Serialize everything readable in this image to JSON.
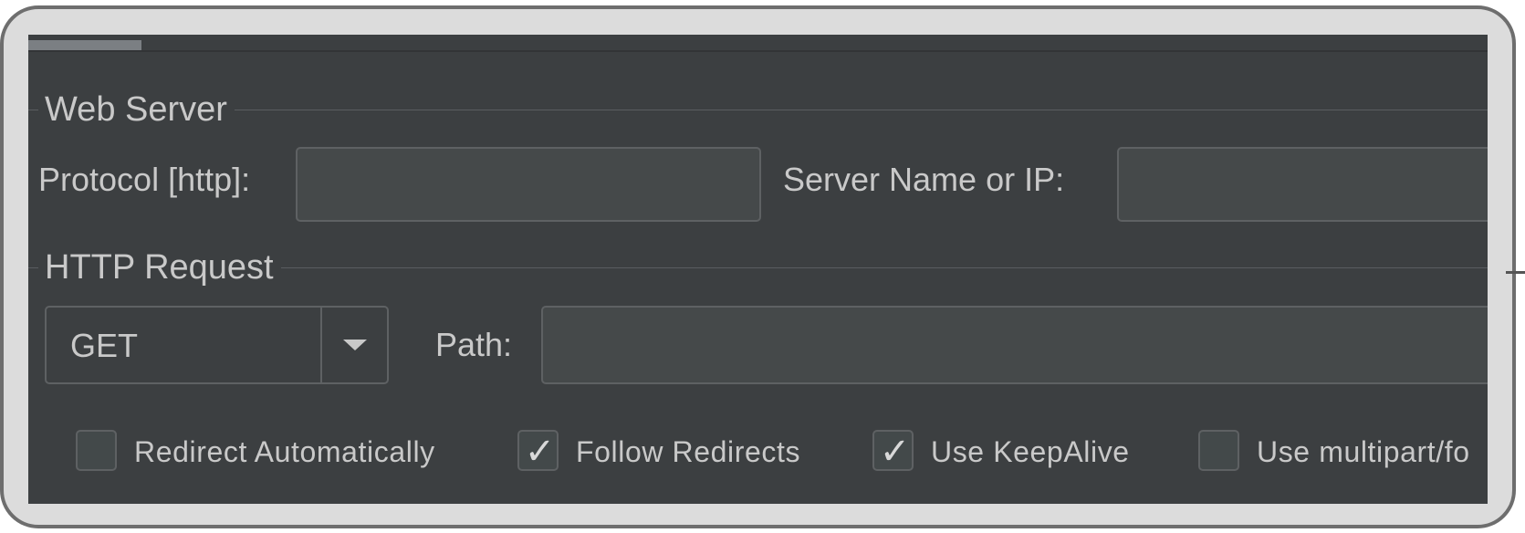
{
  "web_server": {
    "legend": "Web Server",
    "protocol_label": "Protocol [http]:",
    "protocol_value": "",
    "server_label": "Server Name or IP:",
    "server_value": ""
  },
  "http_request": {
    "legend": "HTTP Request",
    "method": "GET",
    "path_label": "Path:",
    "path_value": ""
  },
  "options": [
    {
      "label": "Redirect Automatically",
      "checked": false
    },
    {
      "label": "Follow Redirects",
      "checked": true
    },
    {
      "label": "Use KeepAlive",
      "checked": true
    },
    {
      "label": "Use multipart/fo",
      "checked": false
    }
  ],
  "icons": {
    "dropdown": "chevron-down-icon",
    "check": "checkmark-icon"
  },
  "colors": {
    "panel_bg": "#3c3f41",
    "field_bg": "#45494a",
    "border": "#5e6163",
    "text": "#c9c9c9"
  }
}
